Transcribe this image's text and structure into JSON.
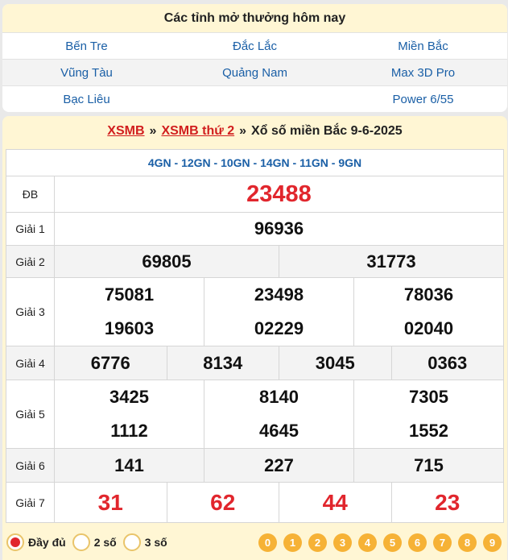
{
  "provinces": {
    "title": "Các tỉnh mở thưởng hôm nay",
    "rows": [
      [
        "Bến Tre",
        "Đắc Lắc",
        "Miền Bắc"
      ],
      [
        "Vũng Tàu",
        "Quảng Nam",
        "Max 3D Pro"
      ],
      [
        "Bạc Liêu",
        "",
        "Power 6/55"
      ]
    ]
  },
  "result": {
    "link1": "XSMB",
    "link2": "XSMB thứ 2",
    "separator": "»",
    "title": "Xổ số miền Bắc 9-6-2025",
    "gn": "4GN - 12GN - 10GN - 14GN - 11GN - 9GN",
    "labels": {
      "db": "ĐB",
      "g1": "Giải 1",
      "g2": "Giải 2",
      "g3": "Giải 3",
      "g4": "Giải 4",
      "g5": "Giải 5",
      "g6": "Giải 6",
      "g7": "Giải 7"
    },
    "db": "23488",
    "g1": "96936",
    "g2": [
      "69805",
      "31773"
    ],
    "g3": [
      "75081",
      "23498",
      "78036",
      "19603",
      "02229",
      "02040"
    ],
    "g4": [
      "6776",
      "8134",
      "3045",
      "0363"
    ],
    "g5": [
      "3425",
      "8140",
      "7305",
      "1112",
      "4645",
      "1552"
    ],
    "g6": [
      "141",
      "227",
      "715"
    ],
    "g7": [
      "31",
      "62",
      "44",
      "23"
    ]
  },
  "controls": {
    "options": [
      "Đầy đủ",
      "2 số",
      "3 số"
    ],
    "selected": "Đầy đủ",
    "digits": [
      "0",
      "1",
      "2",
      "3",
      "4",
      "5",
      "6",
      "7",
      "8",
      "9"
    ]
  },
  "colors": {
    "accent_red": "#e1262d",
    "link_blue": "#1a5fa6",
    "header_bg": "#fff6d4",
    "digit_orange": "#f6b236"
  }
}
